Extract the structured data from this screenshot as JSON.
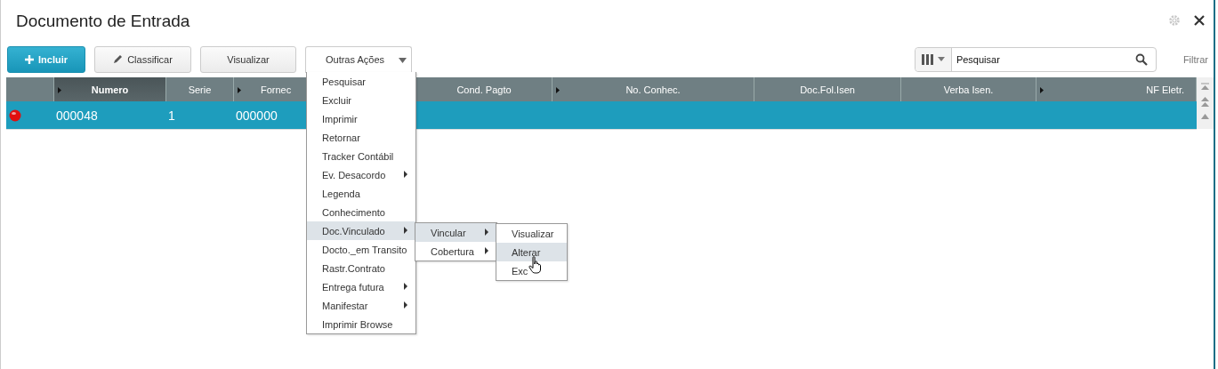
{
  "window": {
    "title": "Documento de Entrada"
  },
  "toolbar": {
    "buttons": [
      {
        "label": "Incluir",
        "kind": "primary"
      },
      {
        "label": "Classificar",
        "kind": "edit"
      },
      {
        "label": "Visualizar",
        "kind": "plain"
      }
    ],
    "menu_button": {
      "label": "Outras Ações"
    },
    "search": {
      "value": "Pesquisar"
    },
    "filter_link": "Filtrar"
  },
  "table": {
    "columns": [
      {
        "arrow": false,
        "selected": false
      },
      {
        "label": "Numero",
        "arrow": true,
        "selected": true
      },
      {
        "label": "Serie",
        "arrow": false,
        "selected": false
      },
      {
        "label": "Fornec",
        "arrow": true,
        "selected": false
      },
      {
        "label": "Cond. Pagto",
        "arrow": false,
        "selected": false
      },
      {
        "label": "No. Conhec.",
        "arrow": true,
        "selected": false
      },
      {
        "label": "Doc.Fol.Isen",
        "arrow": false,
        "selected": false
      },
      {
        "label": "Verba Isen.",
        "arrow": false,
        "selected": false
      },
      {
        "label": "NF Eletr.",
        "arrow": true,
        "selected": false
      }
    ],
    "rows": [
      {
        "color": "#e01010",
        "selected": true,
        "cells": [
          "000048",
          "1",
          "000000",
          "",
          "",
          "",
          "",
          ""
        ]
      }
    ]
  },
  "menu": {
    "items": [
      {
        "label": "Pesquisar",
        "submenu": false,
        "selected": false
      },
      {
        "label": "Excluir",
        "submenu": false,
        "selected": false
      },
      {
        "label": "Imprimir",
        "submenu": false,
        "selected": false
      },
      {
        "label": "Retornar",
        "submenu": false,
        "selected": false
      },
      {
        "label": "Tracker Contábil",
        "submenu": false,
        "selected": false
      },
      {
        "label": "Ev. Desacordo",
        "submenu": true,
        "selected": false
      },
      {
        "label": "Legenda",
        "submenu": false,
        "selected": false
      },
      {
        "label": "Conhecimento",
        "submenu": false,
        "selected": false
      },
      {
        "label": "Doc.Vinculado",
        "submenu": true,
        "selected": true
      },
      {
        "label": "Docto._em Transito",
        "submenu": false,
        "selected": false
      },
      {
        "label": "Rastr.Contrato",
        "submenu": false,
        "selected": false
      },
      {
        "label": "Entrega futura",
        "submenu": true,
        "selected": false
      },
      {
        "label": "Manifestar",
        "submenu": true,
        "selected": false
      },
      {
        "label": "Imprimir Browse",
        "submenu": false,
        "selected": false
      }
    ]
  },
  "submenu": {
    "items": [
      {
        "label": "Vincular",
        "submenu": true,
        "selected": true
      },
      {
        "label": "Cobertura",
        "submenu": true,
        "selected": false
      }
    ]
  },
  "submenu_2": {
    "items": [
      {
        "label": "Visualizar",
        "selected": false
      },
      {
        "label": "Alterar",
        "selected": true
      },
      {
        "label": "Exc",
        "selected": false
      }
    ]
  }
}
